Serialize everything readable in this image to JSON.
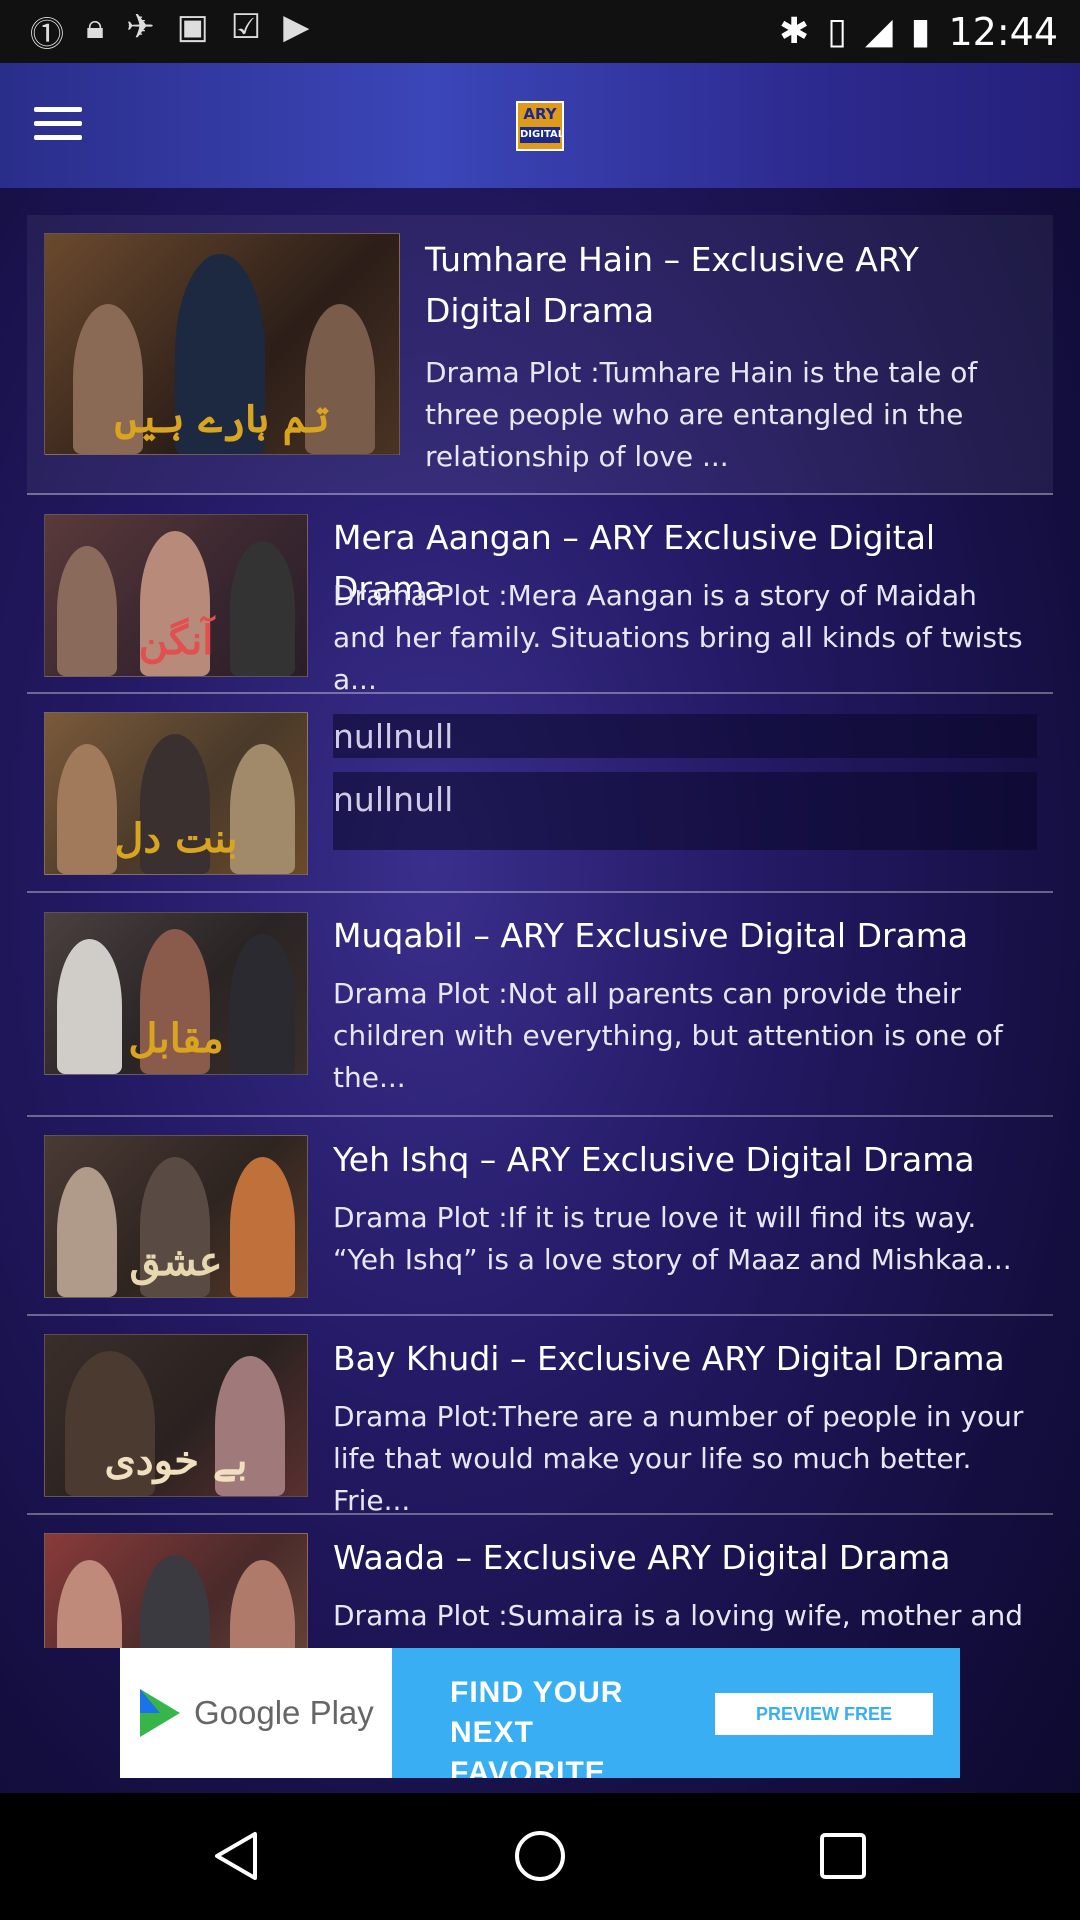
{
  "status_bar": {
    "time": "12:44",
    "left_icons": [
      "notification-icon",
      "lock-icon",
      "fake-gps-icon",
      "calendar-icon",
      "task-icon",
      "youtube-icon"
    ],
    "right_icons": [
      "bluetooth-icon",
      "vibrate-icon",
      "signal-icon",
      "battery-icon"
    ]
  },
  "header": {
    "logo_top": "ARY",
    "logo_bottom": "DIGITAL"
  },
  "dramas": [
    {
      "title": "Tumhare Hain – Exclusive ARY Digital Drama",
      "desc": "Drama Plot :Tumhare Hain is the tale of three people who are entangled in the relationship of love ...",
      "script": "تم ہارے ہیں"
    },
    {
      "title": "Mera Aangan – ARY Exclusive Digital Drama",
      "desc": "Drama Plot :Mera Aangan is a story of Maidah and her family. Situations bring all kinds of twists a...",
      "script": "آنگن"
    },
    {
      "title": "nullnull",
      "desc": "nullnull",
      "script": "بنت دل"
    },
    {
      "title": "Muqabil – ARY Exclusive Digital Drama",
      "desc": "Drama Plot :Not all parents can provide their children with everything, but attention is one of the...",
      "script": "مقابل"
    },
    {
      "title": "Yeh Ishq – ARY Exclusive Digital Drama",
      "desc": "Drama Plot :If it is true love it will find its way. “Yeh Ishq” is a love story of Maaz and Mishkaa...",
      "script": "عشق"
    },
    {
      "title": "Bay Khudi – Exclusive ARY Digital Drama",
      "desc": "Drama Plot:There are a number of people in your life that would make your life so much better. Frie...",
      "script": "بے خودی"
    },
    {
      "title": "Waada  – Exclusive ARY Digital Drama",
      "desc": "Drama Plot :Sumaira is a loving wife, mother and",
      "script": ""
    }
  ],
  "ad": {
    "store": "Google Play",
    "headline": "FIND YOUR NEXT FAVORITE BOOK",
    "cta": "PREVIEW FREE"
  },
  "colors": {
    "background": "#241a66",
    "header": "#3b46b8",
    "ad_blue": "#39aef3",
    "logo_gold": "#e09a1a"
  }
}
